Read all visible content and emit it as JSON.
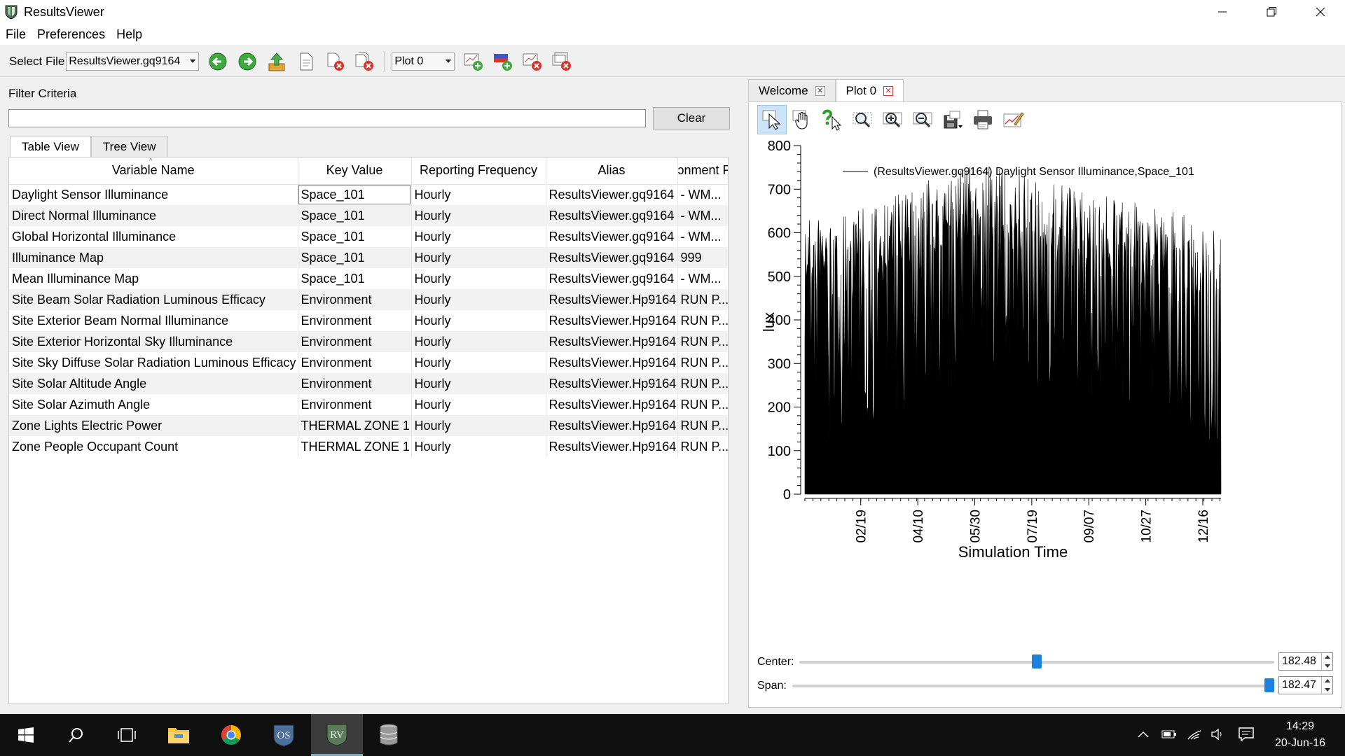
{
  "window": {
    "title": "ResultsViewer"
  },
  "menu": {
    "file": "File",
    "preferences": "Preferences",
    "help": "Help"
  },
  "toolbar": {
    "select_label": "Select File",
    "file_combo": "ResultsViewer.gq9164",
    "plot_combo": "Plot 0"
  },
  "filter": {
    "label": "Filter Criteria",
    "value": "",
    "clear_label": "Clear"
  },
  "left_tabs": [
    "Table View",
    "Tree View"
  ],
  "table": {
    "columns": [
      "Variable Name",
      "Key Value",
      "Reporting Frequency",
      "Alias",
      "ɔnment F"
    ],
    "rows": [
      [
        "Daylight Sensor Illuminance",
        "Space_101",
        "Hourly",
        "ResultsViewer.gq9164",
        "- WM..."
      ],
      [
        "Direct Normal Illuminance",
        "Space_101",
        "Hourly",
        "ResultsViewer.gq9164",
        "- WM..."
      ],
      [
        "Global Horizontal Illuminance",
        "Space_101",
        "Hourly",
        "ResultsViewer.gq9164",
        "- WM..."
      ],
      [
        "Illuminance Map",
        "Space_101",
        "Hourly",
        "ResultsViewer.gq9164",
        "999"
      ],
      [
        "Mean Illuminance Map",
        "Space_101",
        "Hourly",
        "ResultsViewer.gq9164",
        "- WM..."
      ],
      [
        "Site Beam Solar Radiation Luminous Efficacy",
        "Environment",
        "Hourly",
        "ResultsViewer.Hp9164",
        "RUN P..."
      ],
      [
        "Site Exterior Beam Normal Illuminance",
        "Environment",
        "Hourly",
        "ResultsViewer.Hp9164",
        "RUN P..."
      ],
      [
        "Site Exterior Horizontal Sky Illuminance",
        "Environment",
        "Hourly",
        "ResultsViewer.Hp9164",
        "RUN P..."
      ],
      [
        "Site Sky Diffuse Solar Radiation Luminous Efficacy",
        "Environment",
        "Hourly",
        "ResultsViewer.Hp9164",
        "RUN P..."
      ],
      [
        "Site Solar Altitude Angle",
        "Environment",
        "Hourly",
        "ResultsViewer.Hp9164",
        "RUN P..."
      ],
      [
        "Site Solar Azimuth Angle",
        "Environment",
        "Hourly",
        "ResultsViewer.Hp9164",
        "RUN P..."
      ],
      [
        "Zone Lights Electric Power",
        "THERMAL ZONE 1",
        "Hourly",
        "ResultsViewer.Hp9164",
        "RUN P..."
      ],
      [
        "Zone People Occupant Count",
        "THERMAL ZONE 1",
        "Hourly",
        "ResultsViewer.Hp9164",
        "RUN P..."
      ]
    ]
  },
  "right_tabs": [
    "Welcome",
    "Plot 0"
  ],
  "plot_toolbar_icons": [
    "select-pointer-icon",
    "pan-hand-icon",
    "help-pointer-icon",
    "zoom-box-icon",
    "zoom-in-icon",
    "zoom-out-icon",
    "save-image-icon",
    "print-icon",
    "properties-icon"
  ],
  "chart_data": {
    "type": "area",
    "title": "",
    "ylabel": "lux",
    "xlabel": "Simulation Time",
    "ylim": [
      0,
      800
    ],
    "yticks": [
      0,
      100,
      200,
      300,
      400,
      500,
      600,
      700,
      800
    ],
    "xlim": [
      "01/01",
      "12/31"
    ],
    "xtick_labels": [
      "02/19",
      "04/10",
      "05/30",
      "07/19",
      "09/07",
      "10/27",
      "12/16"
    ],
    "legend": "top-left",
    "series": [
      {
        "name": "(ResultsViewer.gq9164) Daylight Sensor Illuminance,Space_101",
        "color": "#000000",
        "x_unit": "month",
        "x": [
          "01",
          "02",
          "03",
          "04",
          "05",
          "06",
          "07",
          "08",
          "09",
          "10",
          "11",
          "12"
        ],
        "daily_peak_max": [
          640,
          640,
          670,
          700,
          740,
          760,
          740,
          720,
          700,
          680,
          660,
          640
        ],
        "daily_peak_min": [
          180,
          190,
          220,
          250,
          290,
          330,
          320,
          300,
          280,
          250,
          210,
          190
        ],
        "daily_base": [
          100,
          120,
          150,
          180,
          220,
          250,
          240,
          220,
          200,
          170,
          130,
          110
        ]
      }
    ]
  },
  "controls": {
    "center_label": "Center:",
    "center_value": "182.48",
    "center_fraction": 0.5,
    "span_label": "Span:",
    "span_value": "182.47",
    "span_fraction": 1.0
  },
  "taskbar": {
    "time": "14:29",
    "date": "20-Jun-16"
  }
}
